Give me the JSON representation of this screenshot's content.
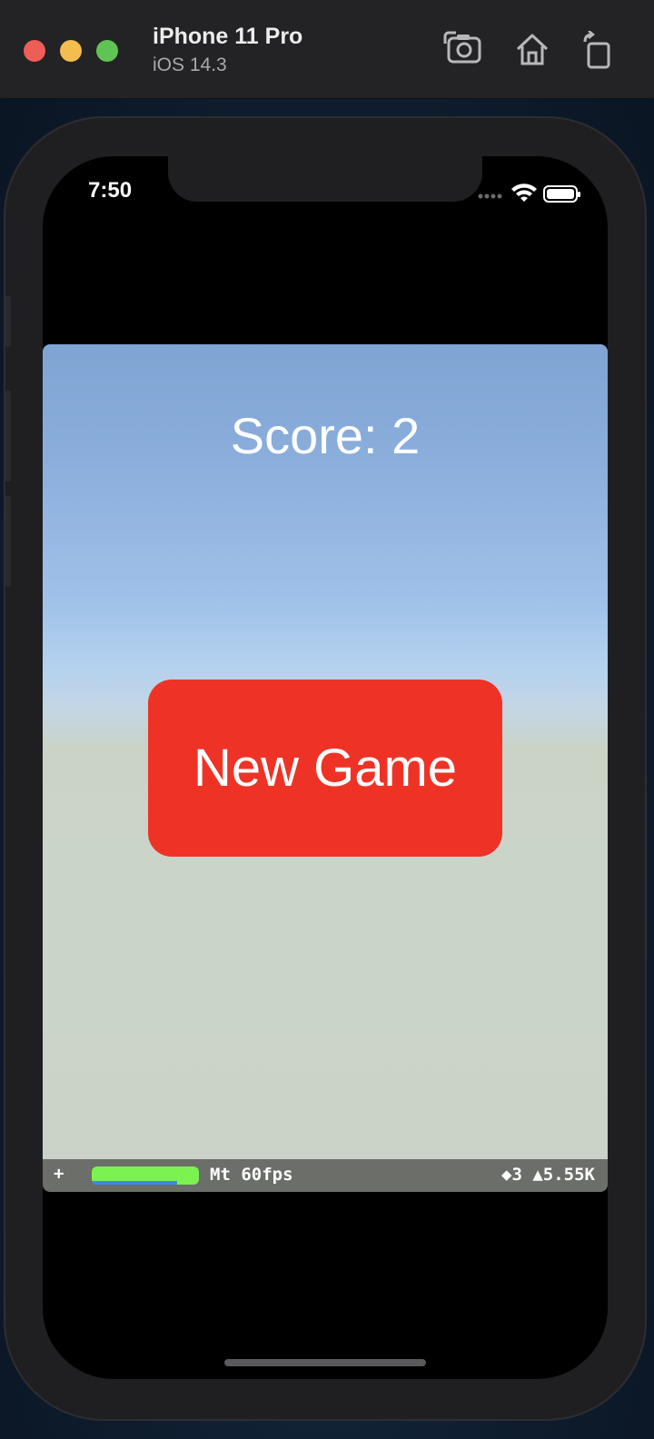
{
  "simulator": {
    "device_name": "iPhone 11 Pro",
    "os_version": "iOS 14.3",
    "buttons": [
      "screenshot-icon",
      "home-icon",
      "rotate-icon"
    ]
  },
  "status_bar": {
    "time": "7:50",
    "icons": [
      "cellular-dots-icon",
      "wifi-icon",
      "battery-icon"
    ]
  },
  "game": {
    "score_text": "Score: 2",
    "new_game_label": "New Game",
    "button_color": "#ee3326"
  },
  "stats": {
    "plus": "+",
    "fps_text": "Mt 60fps",
    "right_text": "◆3 ▲5.55K",
    "fps_bar_color": "#7cf250"
  }
}
